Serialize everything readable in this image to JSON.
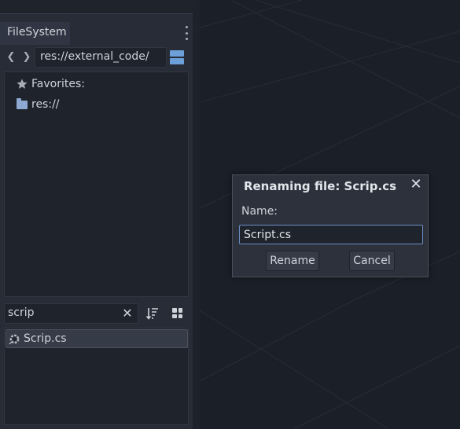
{
  "filesystem_dock": {
    "tab_label": "FileSystem",
    "back_icon": "chevron-left-icon",
    "forward_icon": "chevron-right-icon",
    "path_value": "res://external_code/",
    "tree": {
      "favorites_label": "Favorites:",
      "res_root_label": "res://"
    },
    "filter": {
      "value": "scrip",
      "clear_glyph": "✕"
    },
    "files": [
      {
        "label": "Scrip.cs",
        "icon": "csharp-script-icon"
      }
    ]
  },
  "rename_dialog": {
    "title": "Renaming file: Scrip.cs",
    "close_glyph": "✕",
    "name_label": "Name:",
    "name_value": "Script.cs",
    "rename_label": "Rename",
    "cancel_label": "Cancel"
  },
  "colors": {
    "dock_bg": "#272c37",
    "panel_bg": "#1f232c",
    "viewport_bg": "#1b1f28",
    "accent": "#6da0d8",
    "text": "#cfd3da"
  }
}
